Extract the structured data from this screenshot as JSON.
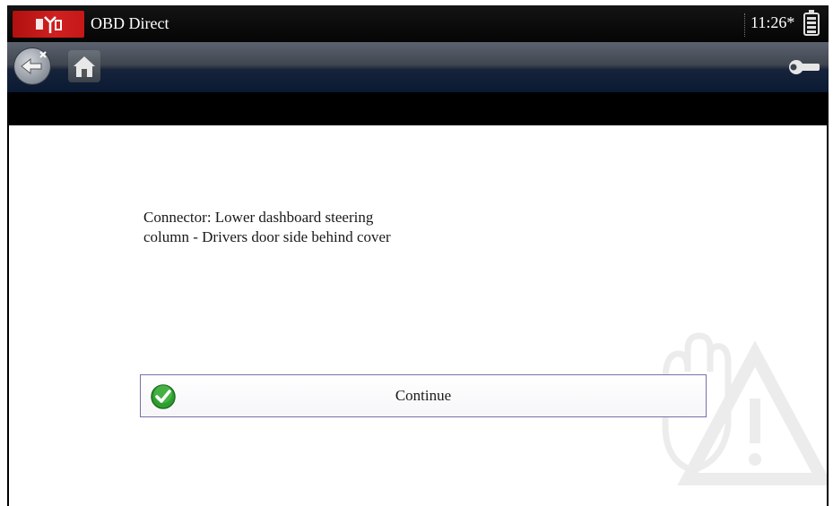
{
  "titlebar": {
    "app_title": "OBD Direct",
    "clock": "11:26*",
    "logo_icon": "scanner-app-icon",
    "battery_icon": "battery-icon"
  },
  "toolbar": {
    "back_icon": "back-arrow-icon",
    "home_icon": "home-icon",
    "tools_icon": "wrench-icon"
  },
  "content": {
    "message": "Connector: Lower dashboard steering column - Drivers door side behind cover",
    "continue_label": "Continue",
    "check_icon": "check-circle-icon",
    "watermark_icon": "warning-hand-icon"
  },
  "colors": {
    "logo_red": "#c61818",
    "check_green": "#2e9e2e",
    "button_border": "#7a6fa8",
    "toolbar_blue": "#0a1a33"
  }
}
